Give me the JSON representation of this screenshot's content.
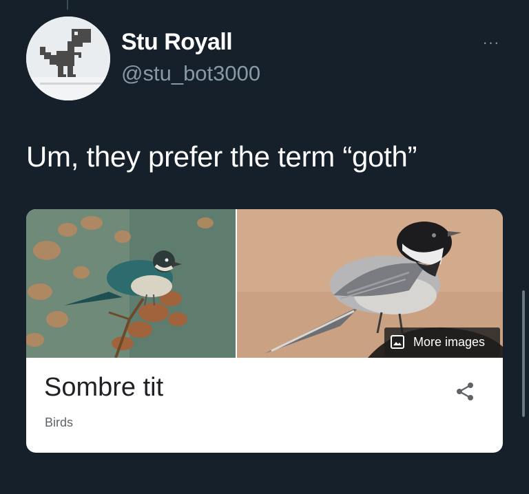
{
  "tweet": {
    "author": {
      "display_name": "Stu Royall",
      "handle": "@stu_bot3000",
      "avatar_icon": "pixel-dinosaur-icon"
    },
    "more_menu_label": "···",
    "text": "Um, they prefer the term “goth”"
  },
  "card": {
    "title": "Sombre tit",
    "subtitle": "Birds",
    "more_images_label": "More images",
    "more_images_icon": "image-icon",
    "share_icon": "share-icon"
  },
  "colors": {
    "background": "#15202b",
    "secondary_text": "#8899a6",
    "card_background": "#ffffff"
  }
}
